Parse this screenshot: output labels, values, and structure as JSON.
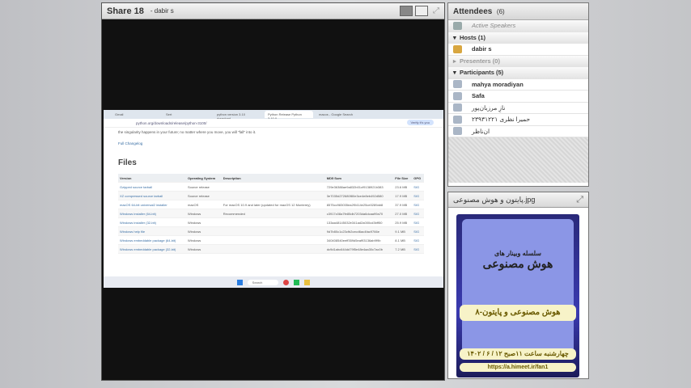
{
  "share": {
    "title": "Share 18",
    "presenter": "- dabir s"
  },
  "browser": {
    "tabs": [
      "Gmail",
      "Sert",
      "python version 3.10 download",
      "Python Release Python 3.10.0",
      "macos - Google Search"
    ],
    "url": "python.org/downloads/release/python-3100/",
    "verify": "Verify it's you",
    "intro": "the singularity happens in your future; no matter where you move, you will \"fall\" into it.",
    "changelog": "Full Changelog",
    "files_heading": "Files",
    "columns": [
      "Version",
      "Operating System",
      "Description",
      "MD5 Sum",
      "File Size",
      "GPG"
    ],
    "rows": [
      [
        "Gzipped source tarball",
        "Source release",
        "",
        "729e36388ae9a832b01cf9138921b383",
        "23.6 MB",
        "SIG"
      ],
      [
        "XZ compressed source tarball",
        "Source release",
        "",
        "3e7035d272680f80e3ce4e8eb492d580",
        "17.9 MB",
        "SIG"
      ],
      [
        "macOS 64-bit universal2 installer",
        "macOS",
        "For macOS 10.9 and later (updated for macOS 12 Monterey)",
        "8575cc983035ea2f0414e25ce0289ab8",
        "37.9 MB",
        "SIG"
      ],
      [
        "Windows installer (64-bit)",
        "Windows",
        "Recommended",
        "c3917c08a7fe85db7203da6dcaa99a70",
        "27.0 MB",
        "SIG"
      ],
      [
        "Windows installer (32-bit)",
        "Windows",
        "",
        "133aa48145032e341ad2a000cd3bff50",
        "25.9 MB",
        "SIG"
      ],
      [
        "Windows help file",
        "Windows",
        "",
        "9d7b80c1c23cfb2cecd6ac4fac9766e",
        "9.1 MB",
        "SIG"
      ],
      [
        "Windows embeddable package (64-bit)",
        "Windows",
        "",
        "340408540eeff359d5eaf93136ab9f9b",
        "8.1 MB",
        "SIG"
      ],
      [
        "Windows embeddable package (32-bit)",
        "Windows",
        "",
        "dc9d1abc644dd79f5e48e4aa30c7ac0b",
        "7.2 MB",
        "SIG"
      ]
    ],
    "taskbar_search": "Search"
  },
  "attendees": {
    "title": "Attendees",
    "count": "(6)",
    "active_speakers": "Active Speakers",
    "hosts": "Hosts (1)",
    "host_names": [
      "dabir s"
    ],
    "presenters": "Presenters (0)",
    "participants": "Participants (5)",
    "participant_names": [
      "mahya moradiyan",
      "Safa",
      "نازِ مرزبان‌پور",
      "۲۳۹۳۱۲۲۱ حمیرا نظری",
      "ان‌ناظر"
    ]
  },
  "image_pod": {
    "title": "پایتون و هوش مصنوعی.jpg",
    "poster_series": "سلسله وبینار های",
    "poster_topic": "هوش مصنوعی",
    "poster_session": "۸-هوش مصنوعی و پایتون",
    "poster_date": "چهارشنبه ساعت ۱۱صبح ۱۲ / ۶ / ۱۴۰۲",
    "poster_link": "https://a.himeet.ir/fan1"
  }
}
